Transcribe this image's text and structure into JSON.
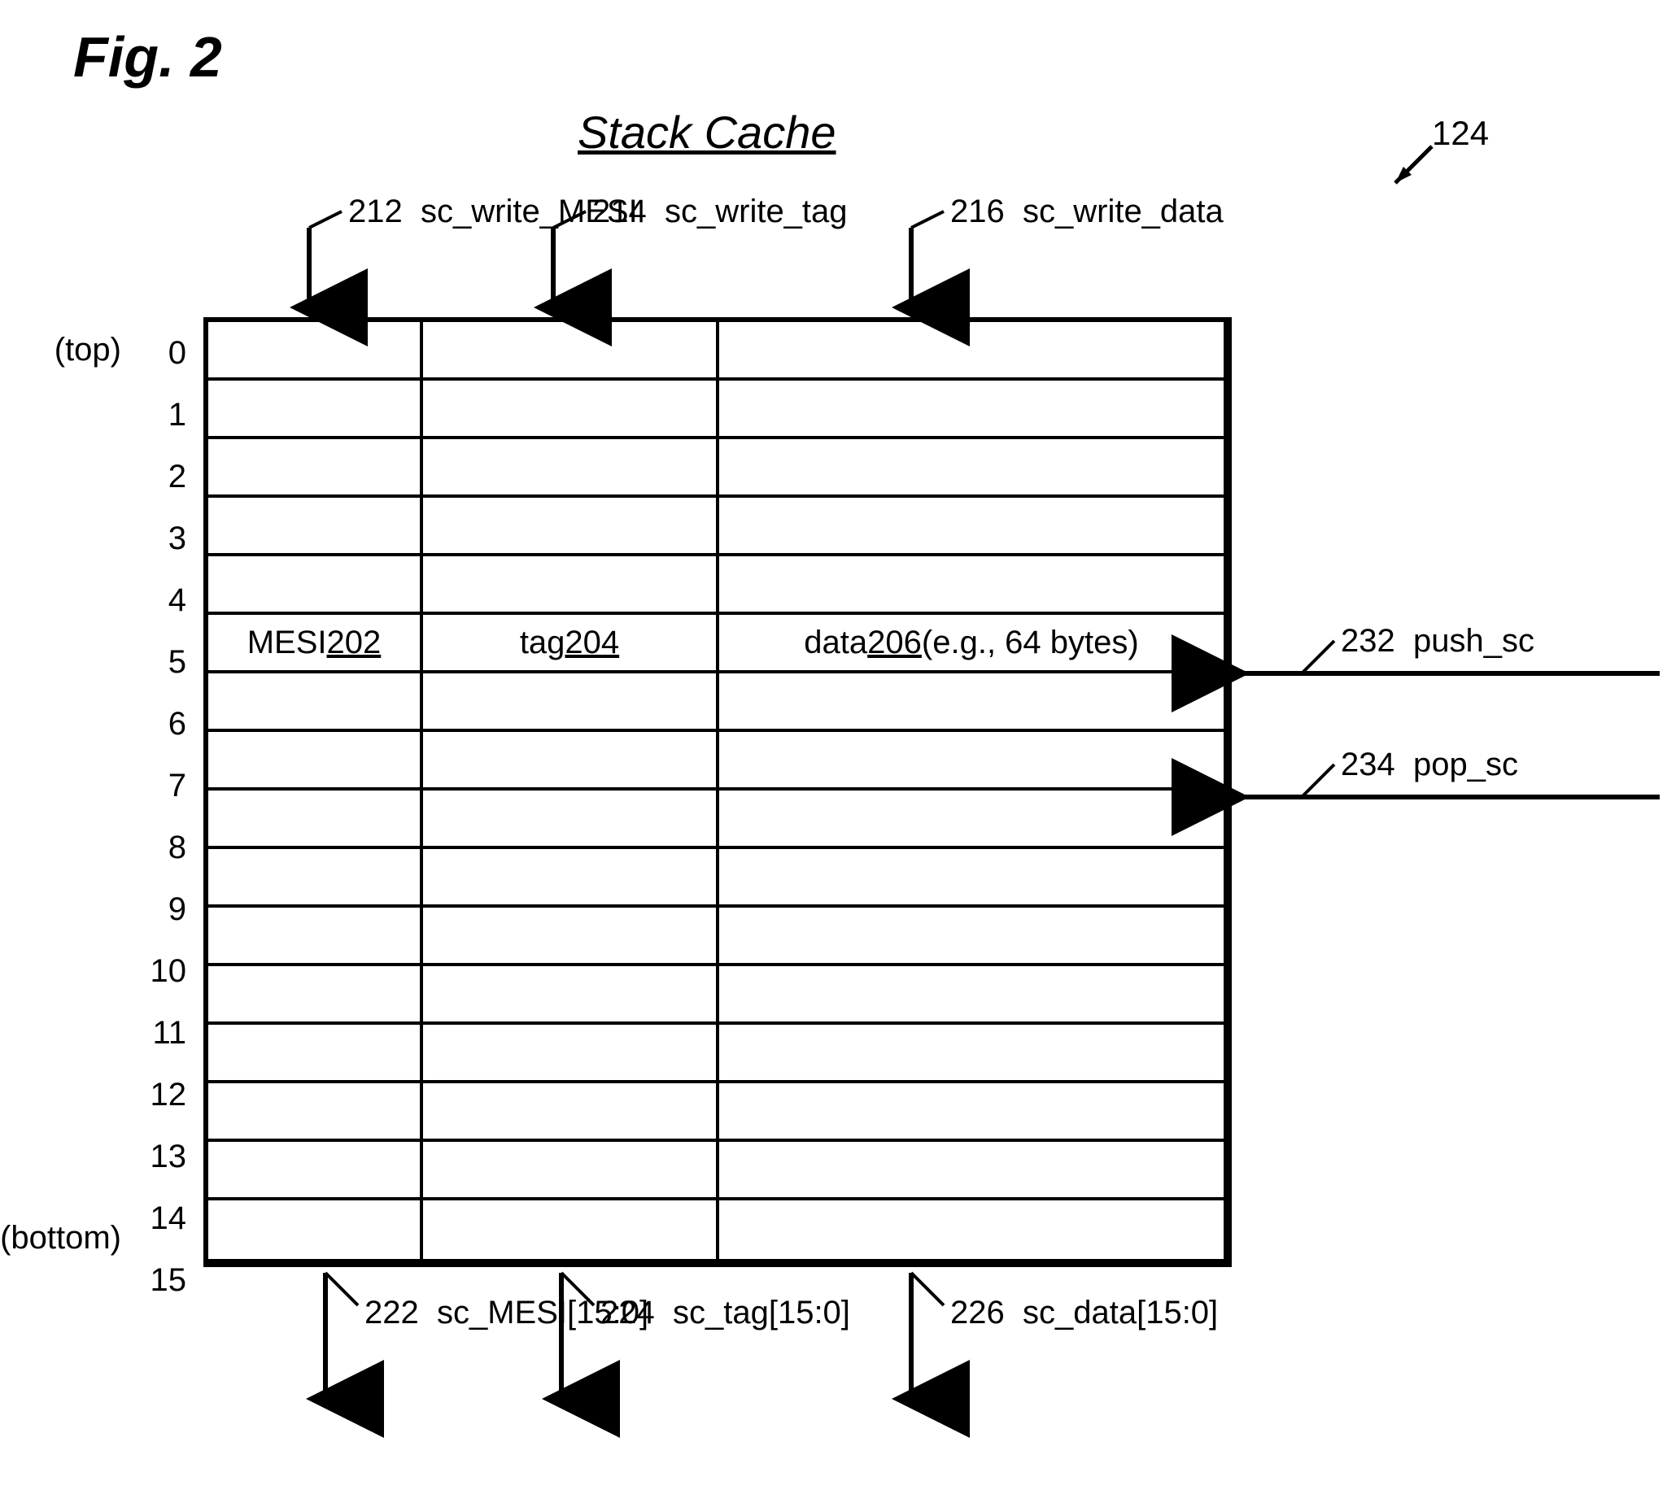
{
  "figure_label": "Fig. 2",
  "title": "Stack Cache",
  "corner_ref": "124",
  "rows": {
    "count": 16,
    "labeled_index": 5,
    "top_label": "(top)",
    "bottom_label": "(bottom)"
  },
  "columns": {
    "col1_label": "MESI ",
    "col1_ref": "202",
    "col2_label": "tag ",
    "col2_ref": "204",
    "col3_label": "data ",
    "col3_ref": "206",
    "col3_suffix": "  (e.g., 64 bytes)"
  },
  "signals": {
    "top": [
      {
        "ref": "212",
        "name": "sc_write_MESI"
      },
      {
        "ref": "214",
        "name": "sc_write_tag"
      },
      {
        "ref": "216",
        "name": "sc_write_data"
      }
    ],
    "bottom": [
      {
        "ref": "222",
        "name": "sc_MESI[15:0]"
      },
      {
        "ref": "224",
        "name": "sc_tag[15:0]"
      },
      {
        "ref": "226",
        "name": "sc_data[15:0]"
      }
    ],
    "right": [
      {
        "ref": "232",
        "name": "push_sc"
      },
      {
        "ref": "234",
        "name": "pop_sc"
      }
    ]
  }
}
